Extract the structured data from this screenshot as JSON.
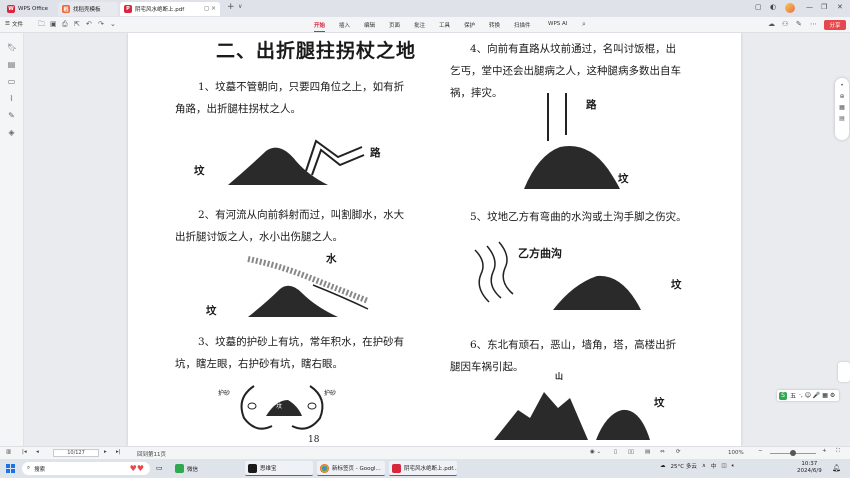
{
  "titlebar": {
    "tabs": [
      {
        "label": "WPS Office"
      },
      {
        "label": "找稻壳模板"
      },
      {
        "label": "阴宅风水绝断上.pdf"
      }
    ],
    "new_tab": "+",
    "new_tab_menu": "∨"
  },
  "ribbon": {
    "file_label": "文件",
    "menus": [
      "开始",
      "插入",
      "编辑",
      "页面",
      "批注",
      "工具",
      "保护",
      "转换",
      "扫描件",
      "WPS AI"
    ],
    "active_menu": "开始",
    "share_label": "分享"
  },
  "document": {
    "heading": "二、出折腿拄拐杖之地",
    "left_col": {
      "p1_line1": "1、坟墓不管朝向，只要四角位之上，如有折",
      "p1_line2": "角路，出折腿柱拐杖之人。",
      "fig1_grave": "坟",
      "fig1_road": "路",
      "p2_line1": "2、有河流从向前斜射而过，叫割脚水，水大",
      "p2_line2": "出折腿讨饭之人，水小出伤腿之人。",
      "fig2_water": "水",
      "fig2_grave": "坟",
      "p3_line1": "3、坟墓的护砂上有坑，常年积水，在护砂有",
      "p3_line2": "坑，瞎左眼，右护砂有坑，瞎右眼。",
      "fig3_left": "护砂",
      "fig3_right": "护砂",
      "fig3_center": "坟",
      "page_number": "18"
    },
    "right_col": {
      "p4_line1": "4、向前有直路从坟前通过，名叫讨饭棍，出",
      "p4_line2": "乞丐，堂中还会出腿病之人，这种腿病多数出自车",
      "p4_line3": "祸，摔灾。",
      "fig4_road": "路",
      "fig4_grave": "坟",
      "p5_line1": "5、坟地乙方有弯曲的水沟或土沟手脚之伤灾。",
      "fig5_label": "乙方曲沟",
      "fig5_grave": "坟",
      "p6_line1": "6、东北有顽石，恶山，墙角，塔，高楼出折",
      "p6_line2": "腿因车祸引起。",
      "fig6_mountain": "山",
      "fig6_grave": "坟"
    }
  },
  "ime": {
    "label": "五",
    "symbols": "·, ☺ 🎤 ▦ ⚙"
  },
  "statusbar": {
    "page_value": "10/127",
    "back_label": "回到第11页",
    "zoom": "100%"
  },
  "taskbar": {
    "search_placeholder": "搜索",
    "apps": [
      {
        "label": "微信"
      },
      {
        "label": "思维宝"
      },
      {
        "label": "新标签页 - Googl..."
      },
      {
        "label": "阴宅风水绝断上.pdf..."
      }
    ],
    "weather": "25°C 多云",
    "ime_indicator": "中",
    "time": "10:37",
    "date": "2024/6/9"
  },
  "colors": {
    "accent": "#d7263d",
    "share": "#e5484d",
    "taskbar_accent": "#1a73e8"
  }
}
